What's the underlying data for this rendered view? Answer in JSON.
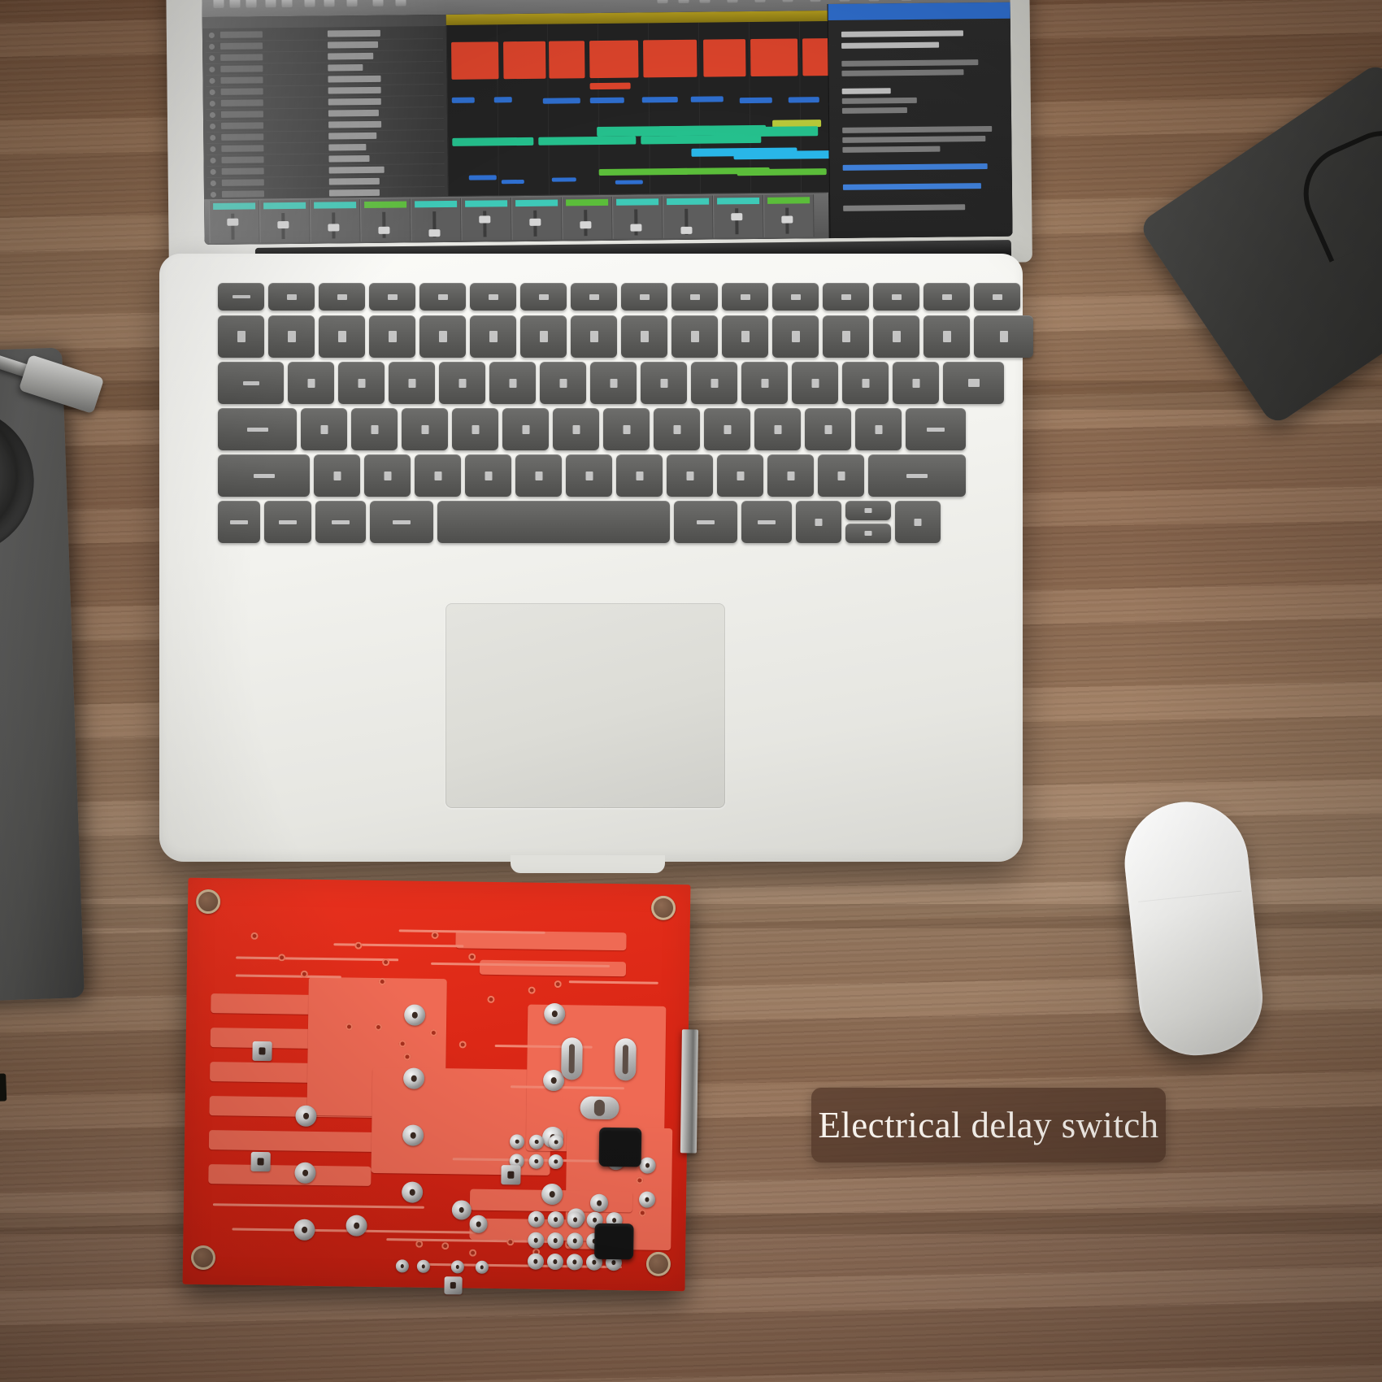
{
  "scene": {
    "title": "Electrical delay switch product photo",
    "background": "wooden desk",
    "wood_color": "#9a7860",
    "wood_shadow": "#7e5a41"
  },
  "caption": {
    "text": "Electrical delay switch",
    "background_color": "#563b2c",
    "text_color": "#fdf8f2"
  },
  "laptop": {
    "name": "laptop",
    "body_color": "#f3f3ef",
    "key_color": "#5c5c5a",
    "trackpad_label": "trackpad",
    "screen": {
      "app": "digital audio workstation",
      "background_color": "#232323",
      "titlebar_color": "#b4b4b4",
      "ruler_color": "#b59e1e",
      "panel_tab_color": "#2f6fd0",
      "clip_colors": [
        "#e0452c",
        "#2f6fd0",
        "#b9c93a",
        "#25c08d",
        "#29b6e8",
        "#5bbd3a"
      ],
      "tracks": [
        {
          "name": "Vocal Lead"
        },
        {
          "name": "Vocal Dbl"
        },
        {
          "name": "Harmony"
        },
        {
          "name": "Pad"
        },
        {
          "name": "Strings Hi"
        },
        {
          "name": "Strings Lo"
        },
        {
          "name": "Piano Main"
        },
        {
          "name": "Rhodes EP"
        },
        {
          "name": "Synth Bass"
        },
        {
          "name": "Sub Bass"
        },
        {
          "name": "Kick"
        },
        {
          "name": "Snare"
        },
        {
          "name": "Hats Closed"
        },
        {
          "name": "Hats Open"
        },
        {
          "name": "Perc Loop"
        },
        {
          "name": "FX Riser"
        },
        {
          "name": "Guitar DI"
        },
        {
          "name": "Guitar Amp"
        },
        {
          "name": "Master Bus"
        }
      ]
    }
  },
  "mouse": {
    "name": "wireless mouse",
    "color": "#f6f6f4"
  },
  "turntable": {
    "name": "turntable",
    "color": "#5a5a58",
    "tonearm_color": "#bdbdba"
  },
  "dark_object": {
    "name": "dark device",
    "color": "#3b3b39"
  },
  "pcb": {
    "name": "electrical delay switch circuit board",
    "board_color": "#dc2a17",
    "trace_color": "#ef6a54",
    "pad_color": "#c8c8c8",
    "connector_color": "#9b9b99",
    "mounting_holes": 4,
    "components": [
      "relay",
      "terminal block",
      "solder pads",
      "copper traces",
      "mounting holes"
    ]
  }
}
